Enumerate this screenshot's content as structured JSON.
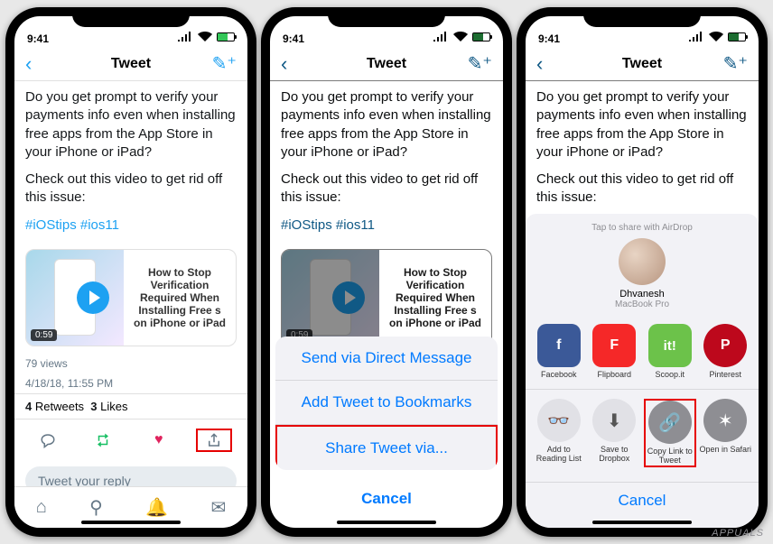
{
  "status": {
    "time": "9:41"
  },
  "header": {
    "title": "Tweet"
  },
  "tweet": {
    "line1": "Do you get prompt to verify your payments info even when installing free apps from the App Store in your iPhone or iPad?",
    "line2": "Check out this video to get rid off this issue:",
    "hashtag1": "#iOStips",
    "hashtag2": "#ios11"
  },
  "video": {
    "duration": "0:59",
    "title": "How to Stop Verification Required When Installing Free s on iPhone or iPad"
  },
  "meta": {
    "views": "79 views",
    "timestamp": "4/18/18, 11:55 PM"
  },
  "stats": {
    "retweets_count": "4",
    "retweets_label": "Retweets",
    "likes_count": "3",
    "likes_label": "Likes"
  },
  "reply_placeholder": "Tweet your reply",
  "action_sheet": {
    "dm": "Send via Direct Message",
    "bookmark": "Add Tweet to Bookmarks",
    "share": "Share Tweet via...",
    "cancel": "Cancel"
  },
  "share_sheet": {
    "airdrop_hint": "Tap to share with AirDrop",
    "airdrop_name": "Dhvanesh",
    "airdrop_device": "MacBook Pro",
    "apps": [
      {
        "label": "Facebook",
        "bg": "#3b5998",
        "glyph": "f"
      },
      {
        "label": "Flipboard",
        "bg": "#f52828",
        "glyph": "F"
      },
      {
        "label": "Scoop.it",
        "bg": "#6cc24a",
        "glyph": "it!"
      },
      {
        "label": "Pinterest",
        "bg": "#bd081c",
        "glyph": "P"
      }
    ],
    "actions": [
      {
        "label": "Add to Reading List",
        "glyph": "👓"
      },
      {
        "label": "Save to Dropbox",
        "glyph": "⬇"
      },
      {
        "label": "Copy Link to Tweet",
        "glyph": "🔗"
      },
      {
        "label": "Open in Safari",
        "glyph": "✶"
      }
    ],
    "cancel": "Cancel"
  },
  "watermark": "APPUALS"
}
